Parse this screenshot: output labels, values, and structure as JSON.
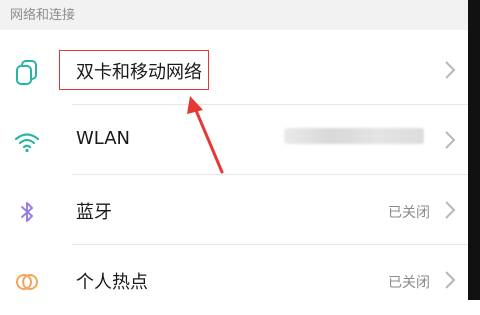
{
  "section": {
    "title": "网络和连接"
  },
  "rows": [
    {
      "label": "双卡和移动网络",
      "status": "",
      "icon": "sim-card-icon"
    },
    {
      "label": "WLAN",
      "status": "",
      "icon": "wifi-icon"
    },
    {
      "label": "蓝牙",
      "status": "已关闭",
      "icon": "bluetooth-icon"
    },
    {
      "label": "个人热点",
      "status": "已关闭",
      "icon": "hotspot-icon"
    }
  ],
  "colors": {
    "accent_teal": "#2bb5a5",
    "bluetooth_purple": "#9b7fe0",
    "hotspot_orange": "#f2a65a",
    "annotation_red": "#e53935"
  }
}
